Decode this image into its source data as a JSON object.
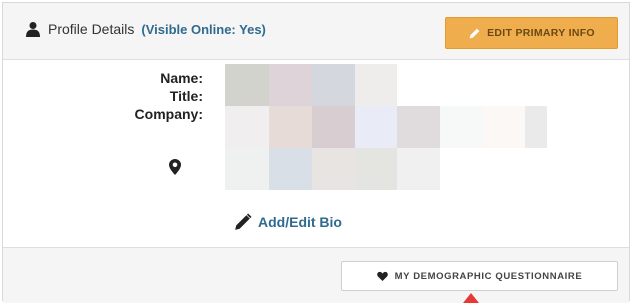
{
  "header": {
    "title": "Profile Details",
    "visibility_label": "(Visible Online: Yes)",
    "edit_button_label": "EDIT PRIMARY INFO"
  },
  "details": {
    "labels": [
      "Name:",
      "Title:",
      "Company:"
    ]
  },
  "bio": {
    "link_label": "Add/Edit Bio"
  },
  "footer": {
    "questionnaire_button_label": "MY DEMOGRAPHIC QUESTIONNAIRE"
  },
  "colors": {
    "accent_orange": "#f0ad4e",
    "link_blue": "#2f6b8f",
    "arrow_red": "#e53935"
  },
  "icons": {
    "header": "user-icon",
    "edit": "pencil-icon",
    "location": "map-pin-icon",
    "bio": "pencil-icon",
    "questionnaire": "heart-icon"
  }
}
